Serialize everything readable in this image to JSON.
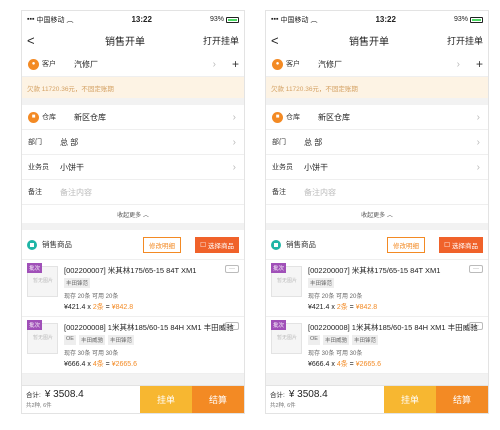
{
  "status": {
    "carrier": "中国移动",
    "time": "13:22",
    "battery": "93%"
  },
  "nav": {
    "back": "<",
    "title": "销售开单",
    "right": "打开挂单"
  },
  "customer": {
    "label": "客户",
    "value": "汽修厂"
  },
  "debt_notice": "欠款 11720.36元，不固定账期",
  "warehouse": {
    "label": "仓库",
    "value": "新区仓库"
  },
  "department": {
    "label": "部门",
    "value": "总 部"
  },
  "salesperson": {
    "label": "业务员",
    "value": "小饼干"
  },
  "remark": {
    "label": "备注",
    "placeholder": "备注内容"
  },
  "collapse": "收起更多",
  "goods": {
    "title": "销售商品",
    "edit_btn": "修改明细",
    "select_btn": "选择商品"
  },
  "items": [
    {
      "tag": "批次",
      "name": "[002200007] 米其林175/65-15 84T XM1",
      "badges": [
        "丰田锋范"
      ],
      "stock": "现存 20条  可用 20条",
      "price": "¥421.4",
      "qty": "2条",
      "total": "¥842.8",
      "placeholder": "暂无图片"
    },
    {
      "tag": "批次",
      "name": "[002200008] 1米其林185/60-15 84H XM1 丰田威驰",
      "badges": [
        "OE",
        "丰田威驰",
        "丰田锋范"
      ],
      "stock": "现存 30条  可用 30条",
      "price": "¥666.4",
      "qty": "4条",
      "total": "¥2665.6",
      "placeholder": "暂无图片"
    }
  ],
  "footer": {
    "total_label": "合计:",
    "total": "¥ 3508.4",
    "count": "共2种, 6件",
    "hang": "挂单",
    "pay": "结算"
  }
}
